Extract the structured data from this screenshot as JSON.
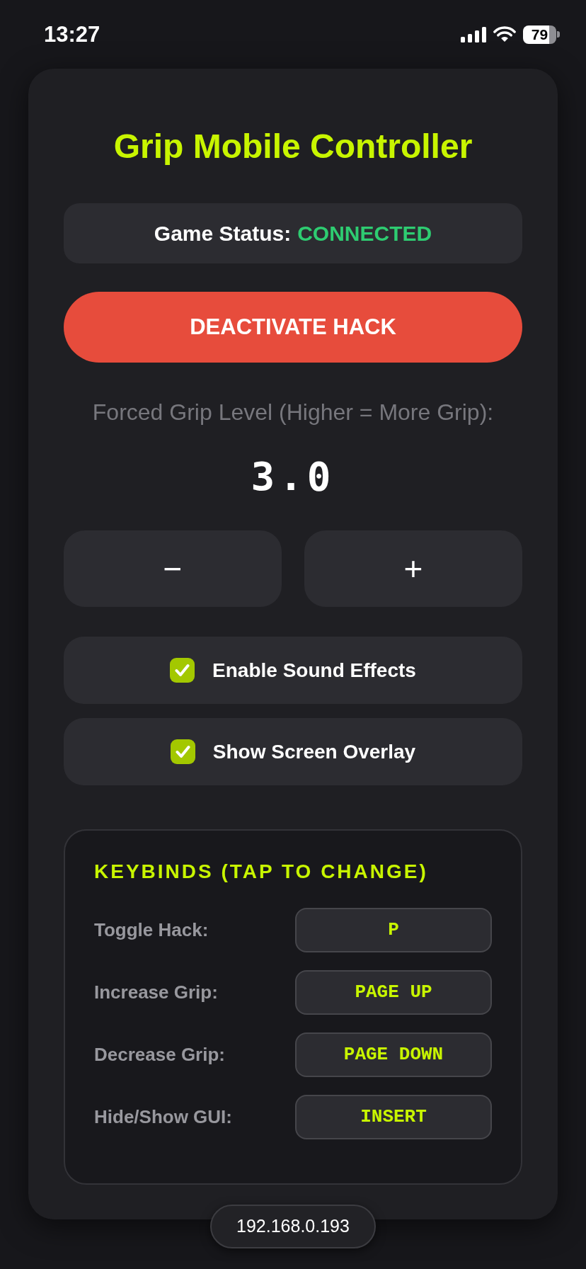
{
  "status_bar": {
    "time": "13:27",
    "battery": "79"
  },
  "title": "Grip Mobile Controller",
  "game_status": {
    "label": "Game Status:",
    "value": "CONNECTED"
  },
  "toggle_button": {
    "label": "DEACTIVATE HACK"
  },
  "grip": {
    "label": "Forced Grip Level (Higher = More Grip):",
    "value": "3.0",
    "buttons": [
      "−",
      "+"
    ]
  },
  "options": [
    {
      "label": "Enable Sound Effects",
      "checked": true
    },
    {
      "label": "Show Screen Overlay",
      "checked": true
    }
  ],
  "keybinds": {
    "title": "KEYBINDS (TAP TO CHANGE)",
    "rows": [
      {
        "action": "Toggle Hack:",
        "key": "P"
      },
      {
        "action": "Increase Grip:",
        "key": "PAGE UP"
      },
      {
        "action": "Decrease Grip:",
        "key": "PAGE DOWN"
      },
      {
        "action": "Hide/Show GUI:",
        "key": "INSERT"
      }
    ]
  },
  "footer": {
    "address": "192.168.0.193"
  }
}
